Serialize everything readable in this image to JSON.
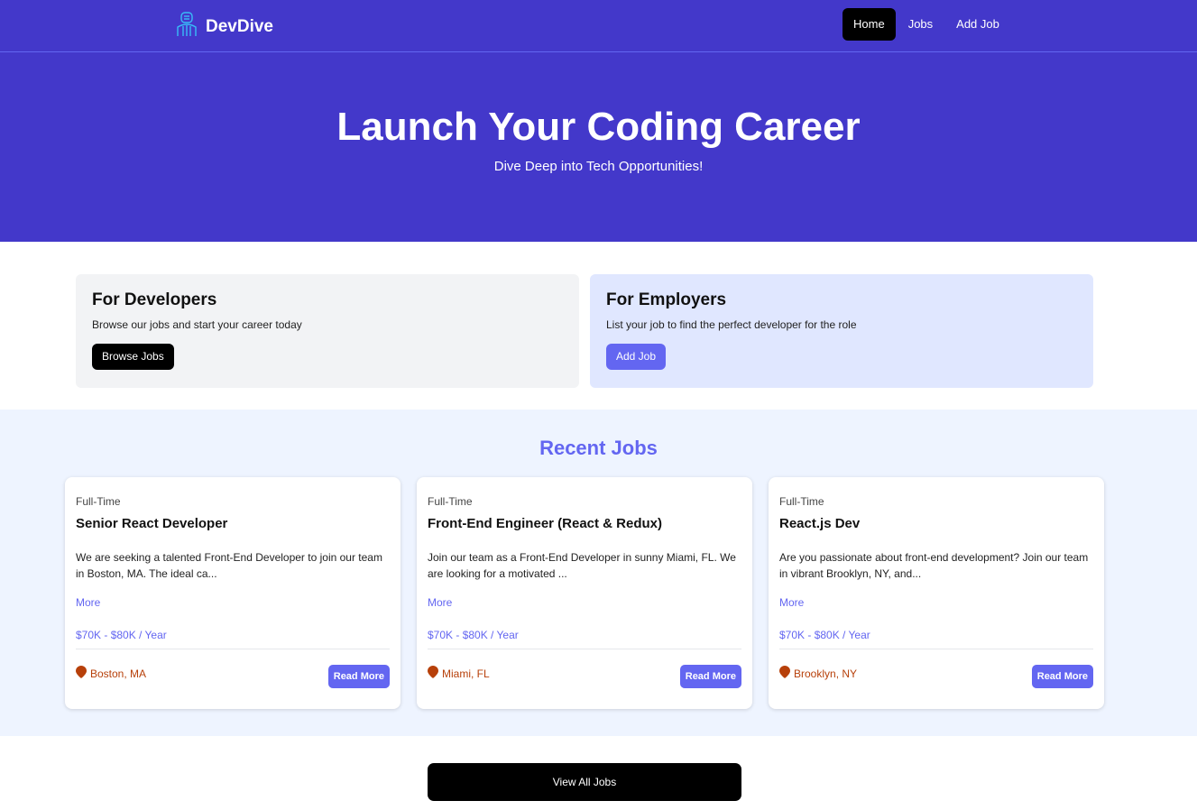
{
  "nav": {
    "brand": "DevDive",
    "links": [
      {
        "label": "Home",
        "active": true
      },
      {
        "label": "Jobs",
        "active": false
      },
      {
        "label": "Add Job",
        "active": false
      }
    ],
    "logo_icon": "developer-icon"
  },
  "hero": {
    "title": "Launch Your Coding Career",
    "subtitle": "Dive Deep into Tech Opportunities!"
  },
  "developers": {
    "title": "For Developers",
    "text": "Browse our jobs and start your career today",
    "button": "Browse Jobs"
  },
  "employers": {
    "title": "For Employers",
    "text": "List your job to find the perfect developer for the role",
    "button": "Add Job"
  },
  "recent": {
    "title": "Recent Jobs",
    "jobs": [
      {
        "type": "Full-Time",
        "title": "Senior React Developer",
        "description": "We are seeking a talented Front-End Developer to join our team in Boston, MA. The ideal ca...",
        "more": "More",
        "salary": "$70K - $80K / Year",
        "location": "Boston, MA",
        "read_more": "Read More"
      },
      {
        "type": "Full-Time",
        "title": "Front-End Engineer (React & Redux)",
        "description": "Join our team as a Front-End Developer in sunny Miami, FL. We are looking for a motivated ...",
        "more": "More",
        "salary": "$70K - $80K / Year",
        "location": "Miami, FL",
        "read_more": "Read More"
      },
      {
        "type": "Full-Time",
        "title": "React.js Dev",
        "description": "Are you passionate about front-end development? Join our team in vibrant Brooklyn, NY, and...",
        "more": "More",
        "salary": "$70K - $80K / Year",
        "location": "Brooklyn, NY",
        "read_more": "Read More"
      }
    ]
  },
  "view_all": "View All Jobs",
  "colors": {
    "primary": "#4338ca",
    "accent": "#6366f1",
    "location": "#b7400a"
  }
}
